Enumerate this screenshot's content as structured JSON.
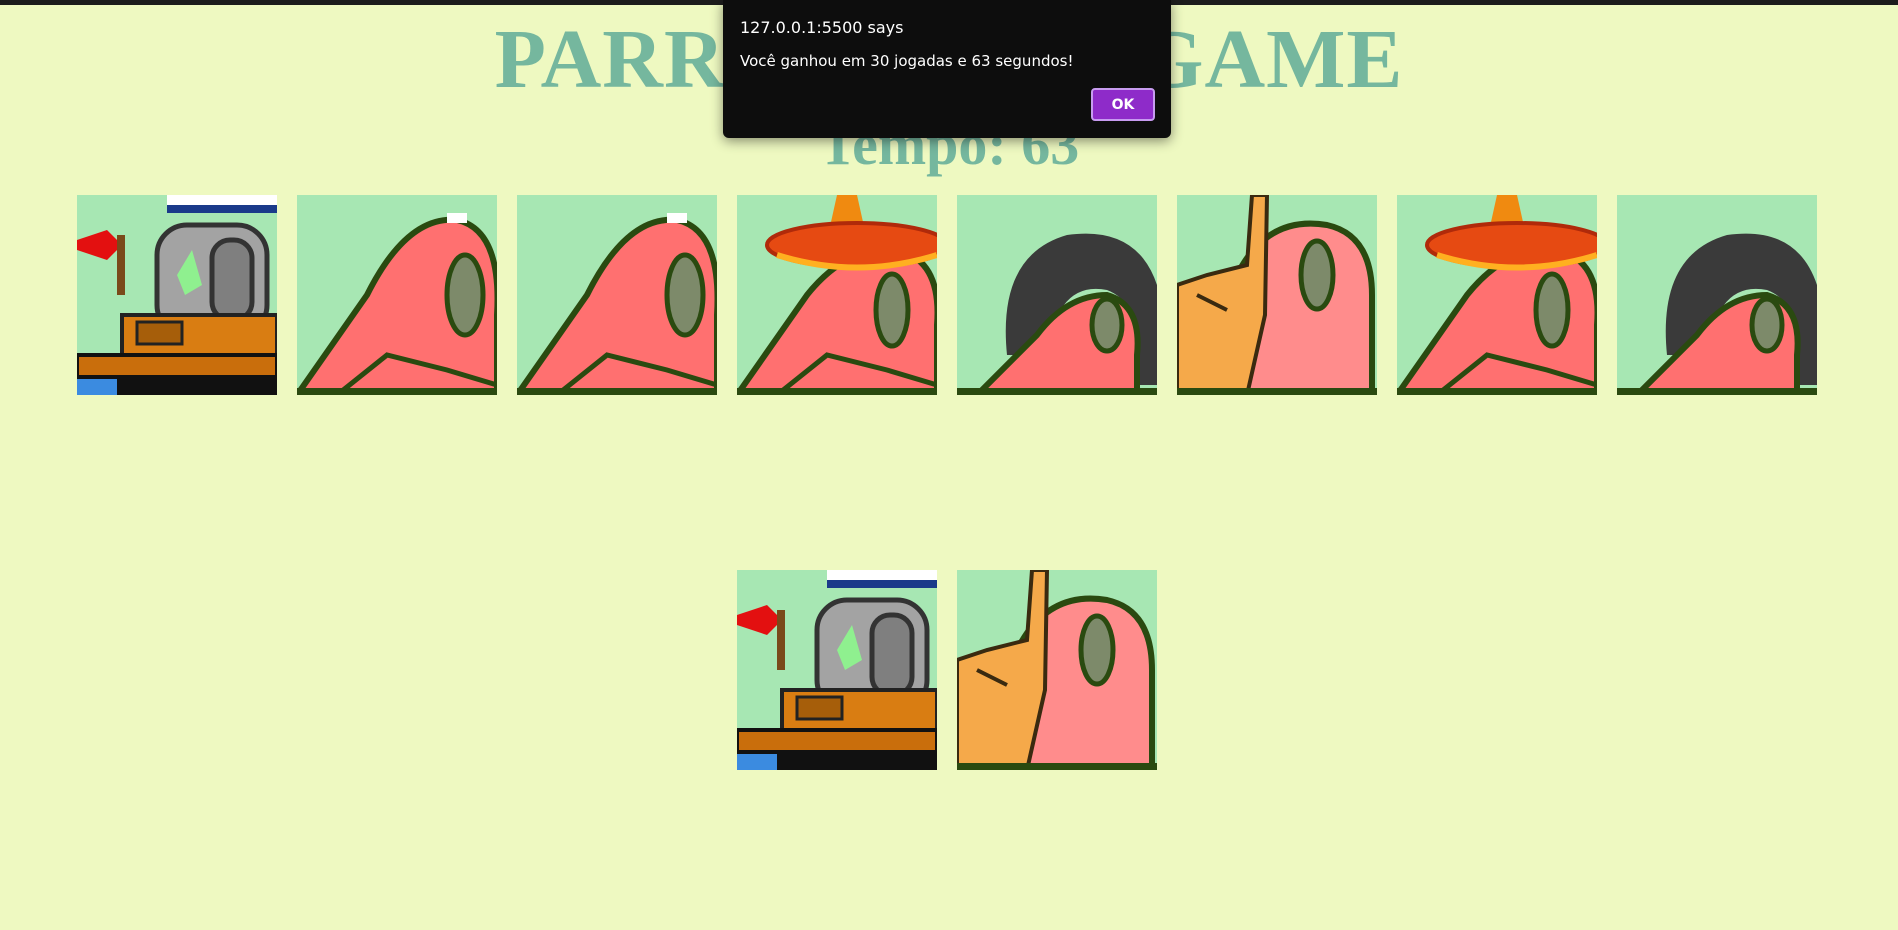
{
  "page": {
    "background": "#EEF9C1",
    "accent": "#75B79E"
  },
  "header": {
    "title": "PARROT CARD GAME"
  },
  "timer": {
    "text": "Tempo: 63"
  },
  "board": {
    "card_back_color": "#A7E7B3",
    "cards": [
      {
        "parrot": "boat-parrot",
        "state": "face-up"
      },
      {
        "parrot": "plain-parrot",
        "state": "face-up"
      },
      {
        "parrot": "plain-parrot",
        "state": "face-up"
      },
      {
        "parrot": "sombrero-parrot",
        "state": "face-up"
      },
      {
        "parrot": "hair-parrot",
        "state": "face-up"
      },
      {
        "parrot": "rock-hand-parrot",
        "state": "face-up"
      },
      {
        "parrot": "sombrero-parrot",
        "state": "face-up"
      },
      {
        "parrot": "hair-parrot",
        "state": "face-up"
      },
      {
        "parrot": "boat-parrot",
        "state": "face-up"
      },
      {
        "parrot": "rock-hand-parrot",
        "state": "face-up"
      }
    ]
  },
  "alert": {
    "origin": "127.0.0.1:5500 says",
    "message": "Você ganhou em 30 jogadas e 63 segundos!",
    "ok_label": "OK",
    "ok_color": "#8E2BC9"
  }
}
